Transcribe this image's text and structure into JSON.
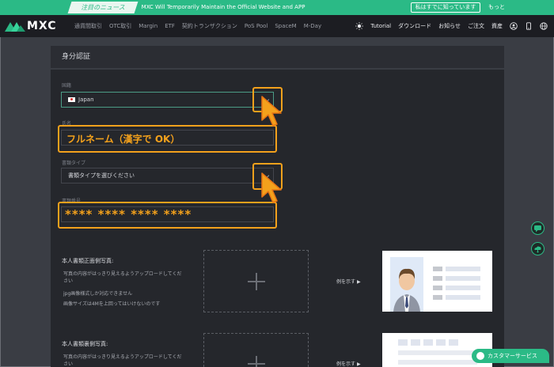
{
  "notice": {
    "tag": "注目のニュース",
    "message": "MXC Will Temporarily Maintain the Official Website and APP",
    "read_button": "私はすでに知っています",
    "more": "もっと"
  },
  "nav": {
    "logo": "MXC",
    "items": [
      "通貨間取引",
      "OTC取引",
      "Margin",
      "ETF",
      "契約トランザクション",
      "PoS Pool",
      "SpaceM",
      "M-Day"
    ],
    "right": {
      "tutorial": "Tutorial",
      "download": "ダウンロード",
      "announce": "お知らせ",
      "orders": "ご注文",
      "assets": "資産"
    }
  },
  "page": {
    "title": "身分認証"
  },
  "form": {
    "country_label": "国籍",
    "country_value": "Japan",
    "name_label": "氏名",
    "name_annotation": "フルネーム（漢字で OK）",
    "doc_type_label": "書類タイプ",
    "doc_type_value": "書類タイプを選びください",
    "doc_number_label": "書類番号",
    "doc_number_annotation": "**** **** **** ****"
  },
  "uploads": [
    {
      "title": "本人書類正面側写真:",
      "notes": [
        "写真の内容がはっきり見えるようアップロードしてください",
        "jpg画像様式しか対応できません",
        "画像サイズは4Mを上回ってはいけないのです"
      ],
      "example": "例を示す"
    },
    {
      "title": "本人書類裏側写真:",
      "notes": [
        "写真の内容がはっきり見えるようアップロードしてください"
      ],
      "example": "例を示す"
    }
  ],
  "support": {
    "chat_label": "カスタマーサービス"
  },
  "colors": {
    "accent": "#2bba86",
    "highlight": "#f3a11c",
    "background": "#25272c"
  }
}
